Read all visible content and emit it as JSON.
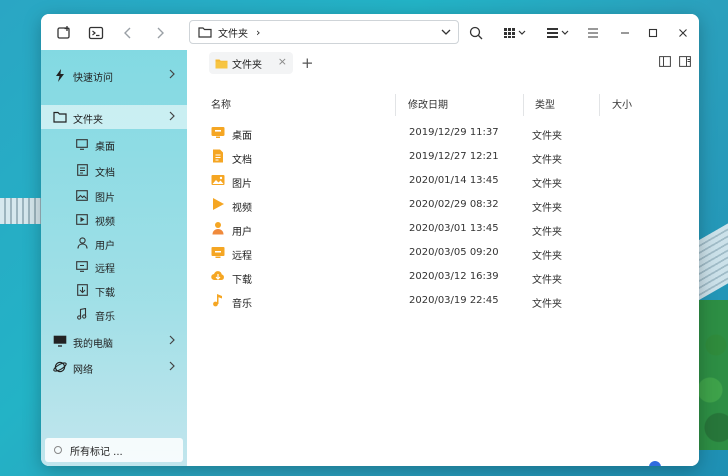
{
  "toolbar": {
    "address_text": "文件夹",
    "address_sep": "›"
  },
  "sidebar": {
    "items": [
      {
        "label": "快速访问",
        "icon": "lightning-icon",
        "has_chevron": true
      },
      {
        "label": "文件夹",
        "icon": "folder-icon",
        "has_chevron": true,
        "active": true
      },
      {
        "label": "桌面",
        "icon": "monitor-icon"
      },
      {
        "label": "文档",
        "icon": "document-icon"
      },
      {
        "label": "图片",
        "icon": "image-icon"
      },
      {
        "label": "视频",
        "icon": "video-icon"
      },
      {
        "label": "用户",
        "icon": "user-icon"
      },
      {
        "label": "远程",
        "icon": "remote-icon"
      },
      {
        "label": "下载",
        "icon": "download-icon"
      },
      {
        "label": "音乐",
        "icon": "music-icon"
      },
      {
        "label": "我的电脑",
        "icon": "computer-icon",
        "has_chevron": true
      },
      {
        "label": "网络",
        "icon": "network-icon",
        "has_chevron": true
      }
    ],
    "tags_label": "所有标记 ..."
  },
  "tabs": [
    {
      "label": "文件夹"
    }
  ],
  "columns": {
    "name": "名称",
    "modified": "修改日期",
    "type": "类型",
    "size": "大小"
  },
  "files": [
    {
      "name": "桌面",
      "modified": "2019/12/29 11:37",
      "type": "文件夹",
      "icon": "desktop-folder-icon",
      "color": "#f5a623"
    },
    {
      "name": "文档",
      "modified": "2019/12/27 12:21",
      "type": "文件夹",
      "icon": "document-folder-icon",
      "color": "#f5a623"
    },
    {
      "name": "图片",
      "modified": "2020/01/14 13:45",
      "type": "文件夹",
      "icon": "picture-folder-icon",
      "color": "#f5a623"
    },
    {
      "name": "视频",
      "modified": "2020/02/29 08:32",
      "type": "文件夹",
      "icon": "video-folder-icon",
      "color": "#f5a623"
    },
    {
      "name": "用户",
      "modified": "2020/03/01 13:45",
      "type": "文件夹",
      "icon": "user-folder-icon",
      "color": "#f5a623"
    },
    {
      "name": "远程",
      "modified": "2020/03/05 09:20",
      "type": "文件夹",
      "icon": "remote-folder-icon",
      "color": "#f5a623"
    },
    {
      "name": "下载",
      "modified": "2020/03/12 16:39",
      "type": "文件夹",
      "icon": "download-folder-icon",
      "color": "#f5a623"
    },
    {
      "name": "音乐",
      "modified": "2020/03/19 22:45",
      "type": "文件夹",
      "icon": "music-folder-icon",
      "color": "#f5a623"
    }
  ],
  "icon_size_slider": {
    "value": 0
  },
  "colors": {
    "accent": "#2f6bdf",
    "folder": "#f5a623",
    "sidebar": "#7fd6e0"
  }
}
